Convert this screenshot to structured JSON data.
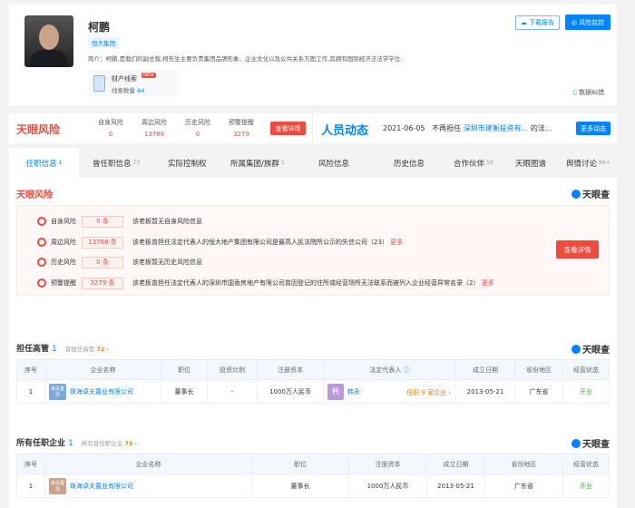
{
  "profile": {
    "name": "柯鹏",
    "tag": "恒大集团",
    "intro": "简介：柯鹏,是我们的副总裁,柯先生主要负责集团品牌形象、企业文化以及公共关系方面工作,其拥有国际经济法法学学位.",
    "asset_label": "财产线索",
    "asset_badge": "NEW",
    "asset_count_label": "线索数量",
    "asset_count": "64",
    "download_btn": "下载报告",
    "monitor_btn": "风险监控",
    "correction": "数据纠错"
  },
  "risk_bar": {
    "logo": "天眼风险",
    "items": [
      {
        "label": "自身风险",
        "value": "0"
      },
      {
        "label": "周边风险",
        "value": "13788"
      },
      {
        "label": "历史风险",
        "value": "0"
      },
      {
        "label": "预警提醒",
        "value": "3279"
      }
    ],
    "detail_btn": "查看详情",
    "dyn_logo": "人员动态",
    "dyn_date": "2021-06-05",
    "dyn_prefix": "不再担任",
    "dyn_company": "深圳市建衡投资有...",
    "dyn_suffix": "的法...",
    "more_btn": "更多动态"
  },
  "tabs": [
    {
      "label": "任职信息",
      "count": "1"
    },
    {
      "label": "曾任职信息",
      "count": "73"
    },
    {
      "label": "实际控制权",
      "count": ""
    },
    {
      "label": "所属集团/族群",
      "count": "1"
    },
    {
      "label": "风险信息",
      "count": ""
    },
    {
      "label": "历史信息",
      "count": ""
    },
    {
      "label": "合作伙伴",
      "count": "10"
    },
    {
      "label": "天眼图谱",
      "count": ""
    },
    {
      "label": "舆情讨论",
      "count": "99+"
    }
  ],
  "risk_section": {
    "title": "天眼风险",
    "brand": "天眼查",
    "detail_btn": "查看详情",
    "more": "更多",
    "rows": [
      {
        "label": "自身风险",
        "count": "0 条",
        "text": "该老板暂无自身风险信息",
        "more": false
      },
      {
        "label": "周边风险",
        "count": "13788 条",
        "text": "该老板曾担任法定代表人的恒大地产集团有限公司是最高人民法院所公示的失信公司（23）",
        "more": true
      },
      {
        "label": "历史风险",
        "count": "0 条",
        "text": "该老板暂无历史风险信息",
        "more": false
      },
      {
        "label": "预警提醒",
        "count": "3279 条",
        "text": "该老板曾担任法定代表人的深圳市国香房地产有限公司曾因登记的住所或经营场所无法联系而被列入企业经营异常名录（2）",
        "more": true
      }
    ]
  },
  "exec_section": {
    "title": "担任高管",
    "count": "1",
    "link": "曾担任高管",
    "link_count": "72",
    "brand": "天眼查",
    "headers": [
      "序号",
      "企业名称",
      "职位",
      "投资比例",
      "注册资本",
      "法定代表人",
      "成立日期",
      "省份地区",
      "经营状态"
    ],
    "rows": [
      {
        "idx": "1",
        "logo": "卓夫置业",
        "company": "珠海卓夫置业有限公司",
        "position": "董事长",
        "ratio": "-",
        "capital": "1000万人民币",
        "rep_avatar": "韩",
        "rep": "韩永",
        "rep_link": "任职 9 家企业",
        "date": "2013-05-21",
        "region": "广东省",
        "status": "开业"
      }
    ]
  },
  "all_section": {
    "title": "所有任职企业",
    "count": "1",
    "link": "所有曾任职企业",
    "link_count": "73",
    "brand": "天眼查",
    "headers": [
      "序号",
      "企业名称",
      "职位",
      "注册资本",
      "成立日期",
      "省份地区",
      "经营状态"
    ],
    "rows": [
      {
        "idx": "1",
        "logo": "卓夫置业",
        "company": "珠海卓夫置业有限公司",
        "position": "董事长",
        "capital": "1000万人民币",
        "date": "2013-05-21",
        "region": "广东省",
        "status": "开业"
      }
    ]
  }
}
